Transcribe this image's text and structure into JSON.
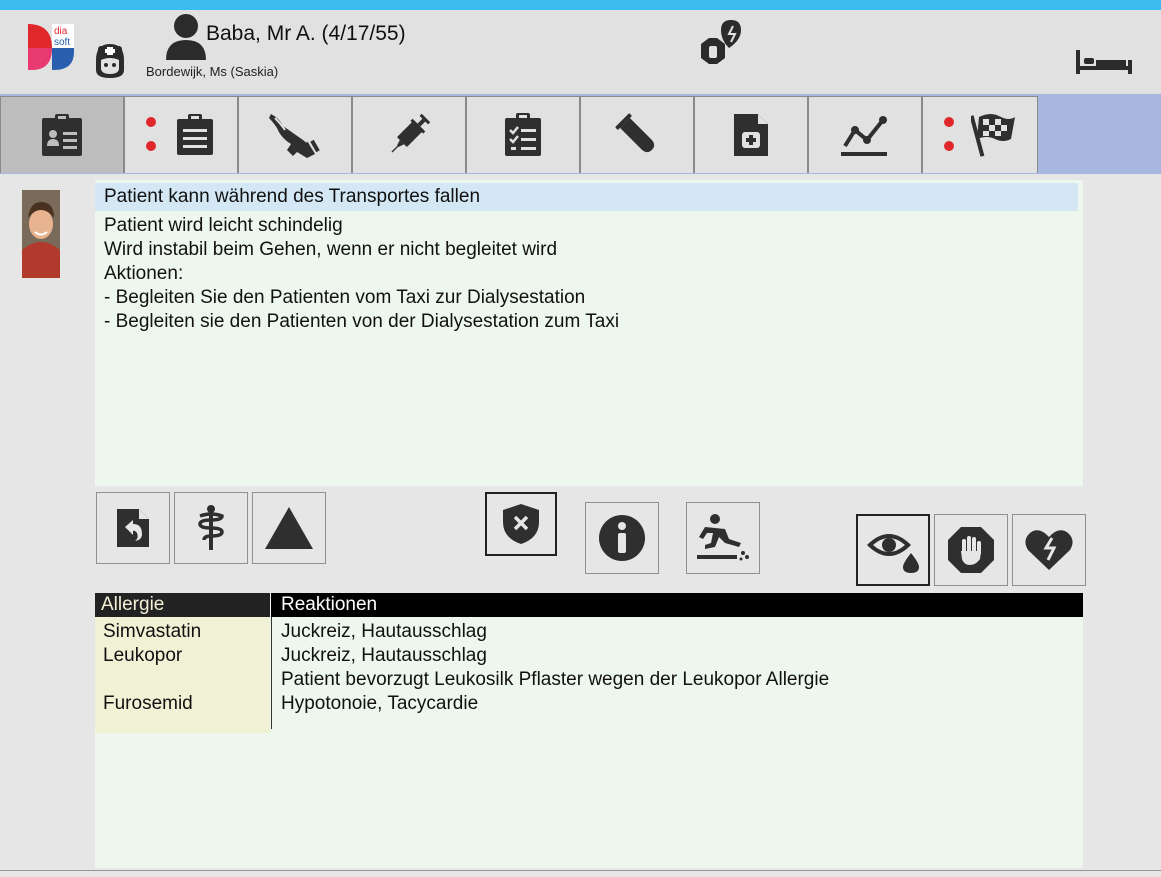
{
  "header": {
    "patient_name": "Baba, Mr A. (4/17/55)",
    "nurse_name": "Bordewijk, Ms (Saskia)",
    "logo_text_top": "dia",
    "logo_text_bottom": "soft",
    "icons": [
      "nurse-icon",
      "patient-icon",
      "heart-hand-alert-icon",
      "bed-icon"
    ]
  },
  "tabs": [
    {
      "name": "tab-patient-record",
      "icon": "clipboard-id-icon",
      "active": true,
      "alert": false
    },
    {
      "name": "tab-notes",
      "icon": "clipboard-icon",
      "active": false,
      "alert": true
    },
    {
      "name": "tab-access",
      "icon": "arm-access-icon",
      "active": false,
      "alert": false
    },
    {
      "name": "tab-injection",
      "icon": "syringe-icon",
      "active": false,
      "alert": false
    },
    {
      "name": "tab-checklist",
      "icon": "clipboard-check-icon",
      "active": false,
      "alert": false
    },
    {
      "name": "tab-lab",
      "icon": "test-tube-icon",
      "active": false,
      "alert": false
    },
    {
      "name": "tab-prescription",
      "icon": "medical-document-icon",
      "active": false,
      "alert": false
    },
    {
      "name": "tab-trend",
      "icon": "line-chart-icon",
      "active": false,
      "alert": false
    },
    {
      "name": "tab-finish",
      "icon": "checkered-flag-icon",
      "active": false,
      "alert": true
    }
  ],
  "note": {
    "title": "Patient kann während des Transportes fallen",
    "lines": [
      "Patient wird leicht schindelig",
      "Wird instabil beim Gehen, wenn er nicht begleitet wird",
      "Aktionen:",
      "- Begleiten Sie den Patienten vom Taxi zur Dialysestation",
      "- Begleiten sie den Patienten von der Dialysestation zum Taxi"
    ]
  },
  "action_buttons": [
    "back-icon",
    "caduceus-icon",
    "warning-triangle-icon",
    "shield-x-icon",
    "info-icon",
    "fall-risk-icon",
    "eye-drop-icon",
    "stop-hand-icon",
    "broken-heart-icon"
  ],
  "allergy_table": {
    "headers": [
      "Allergie",
      "Reaktionen"
    ],
    "rows": [
      {
        "allergen": "Simvastatin",
        "reaction": "Juckreiz, Hautausschlag"
      },
      {
        "allergen": "Leukopor",
        "reaction": "Juckreiz, Hautausschlag"
      },
      {
        "allergen": "",
        "reaction": "Patient bevorzugt Leukosilk Pflaster wegen der Leukopor Allergie"
      },
      {
        "allergen": "Furosemid",
        "reaction": "Hypotonoie, Tacycardie"
      }
    ]
  },
  "colors": {
    "top_accent": "#3bbdf0",
    "tabbar": "#a8b7df",
    "alert_red": "#e0282c",
    "note_title_bg": "#d3e8f4",
    "panel_bg": "#eef7ee"
  }
}
